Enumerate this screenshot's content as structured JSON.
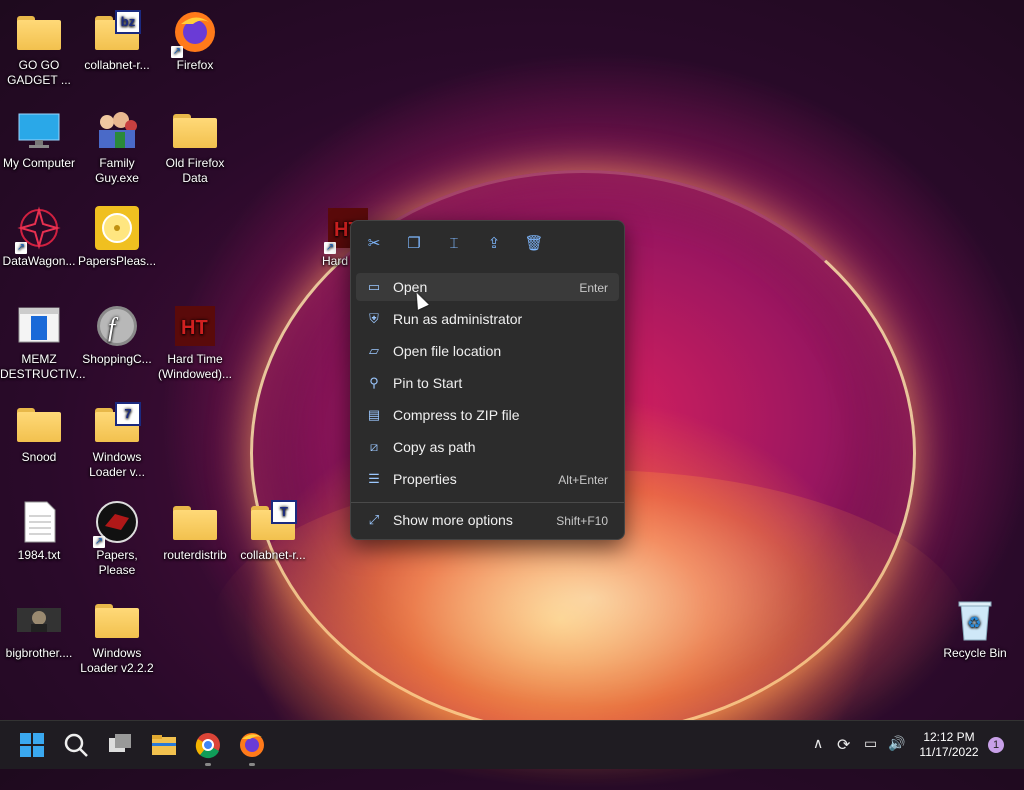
{
  "desktop": {
    "icons": [
      {
        "label": "GO GO\nGADGET ..."
      },
      {
        "label": "collabnet-r...",
        "badge": "bz"
      },
      {
        "label": "Firefox"
      },
      {
        "label": "My Computer"
      },
      {
        "label": "Family\nGuy.exe"
      },
      {
        "label": "Old Firefox\nData"
      },
      {
        "label": "DataWagon..."
      },
      {
        "label": "PapersPleas..."
      },
      {
        "label": "Hard"
      },
      {
        "label": "MEMZ\nDESTRUCTIV..."
      },
      {
        "label": "ShoppingC..."
      },
      {
        "label": "Hard Time\n(Windowed)..."
      },
      {
        "label": "Snood"
      },
      {
        "label": "Windows\nLoader v...",
        "badge": "7"
      },
      {
        "label": "1984.txt"
      },
      {
        "label": "Papers, Please"
      },
      {
        "label": "routerdistrib"
      },
      {
        "label": "collabnet-r...",
        "badge": "T"
      },
      {
        "label": "bigbrother...."
      },
      {
        "label": "Windows\nLoader v2.2.2"
      },
      {
        "label": "Recycle Bin"
      }
    ]
  },
  "context_menu": {
    "toolbar": [
      "cut-icon",
      "copy-icon",
      "rename-icon",
      "share-icon",
      "delete-icon"
    ],
    "items": [
      {
        "label": "Open",
        "shortcut": "Enter"
      },
      {
        "label": "Run as administrator",
        "shortcut": ""
      },
      {
        "label": "Open file location",
        "shortcut": ""
      },
      {
        "label": "Pin to Start",
        "shortcut": ""
      },
      {
        "label": "Compress to ZIP file",
        "shortcut": ""
      },
      {
        "label": "Copy as path",
        "shortcut": ""
      },
      {
        "label": "Properties",
        "shortcut": "Alt+Enter"
      },
      {
        "label": "Show more options",
        "shortcut": "Shift+F10"
      }
    ]
  },
  "taskbar": {
    "time": "12:12 PM",
    "date": "11/17/2022",
    "notification_count": "1"
  },
  "colors": {
    "menu_bg": "#2c2c2c",
    "accent": "#7fb8ff",
    "taskbar_bg": "#1f1c22"
  }
}
